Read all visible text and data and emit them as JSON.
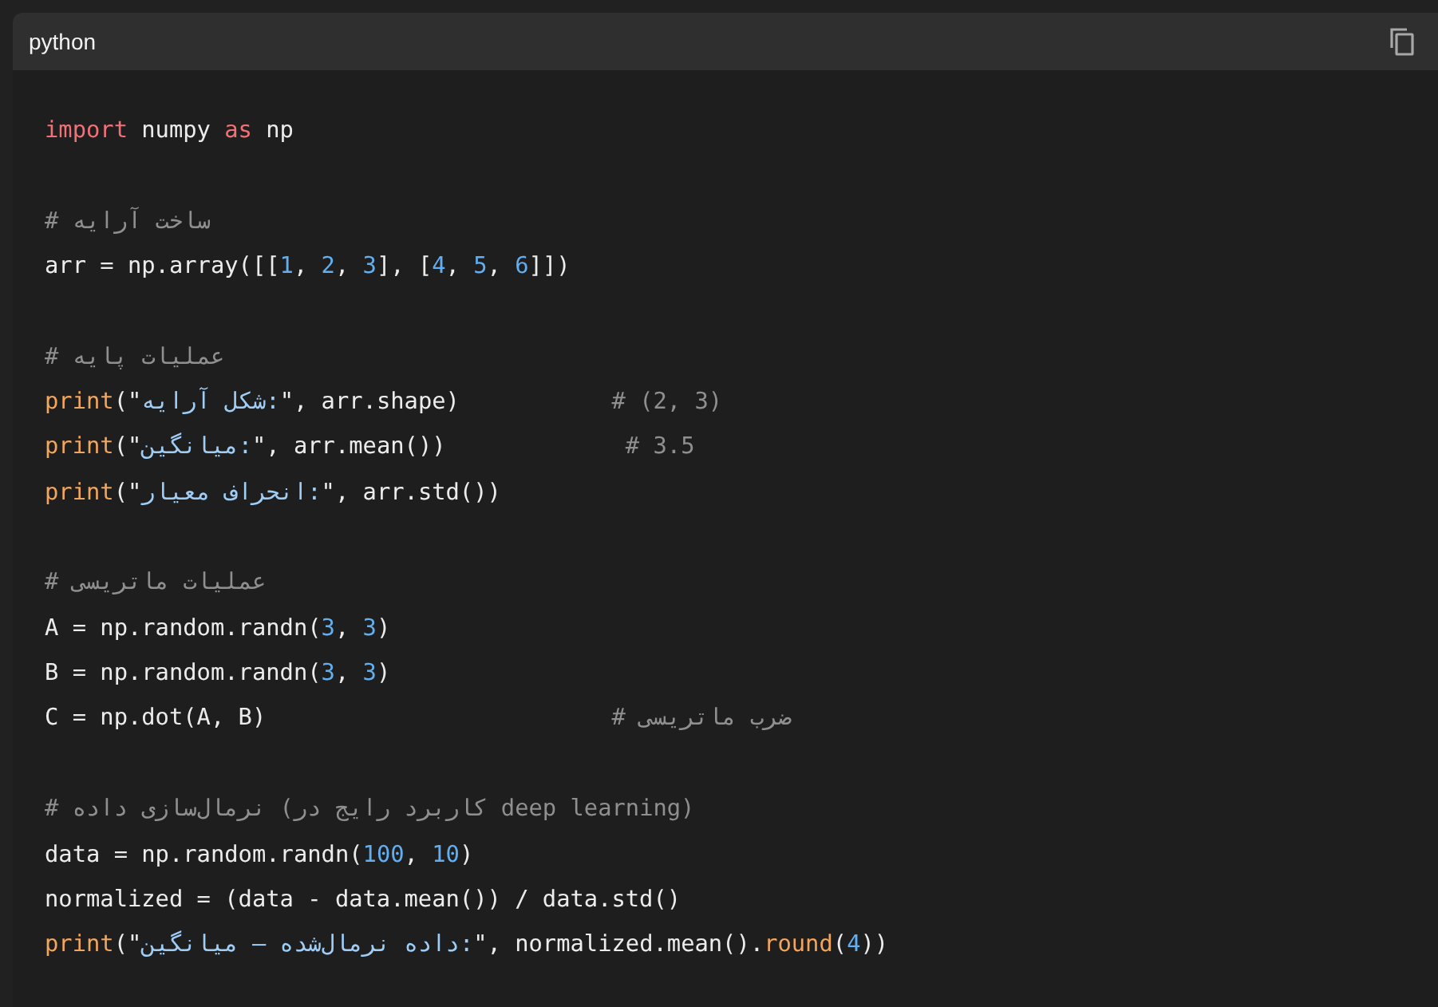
{
  "code_block": {
    "language": "python",
    "lines": [
      {
        "kind": "code",
        "tokens": [
          {
            "kind": "keyword",
            "text": "import"
          },
          {
            "kind": "plain",
            "text": " numpy "
          },
          {
            "kind": "keyword",
            "text": "as"
          },
          {
            "kind": "plain",
            "text": " np"
          }
        ]
      },
      {
        "kind": "blank"
      },
      {
        "kind": "code",
        "tokens": [
          {
            "kind": "comment",
            "text": "# ساخت آرایه"
          }
        ]
      },
      {
        "kind": "code",
        "tokens": [
          {
            "kind": "plain",
            "text": "arr = np.array([["
          },
          {
            "kind": "number",
            "text": "1"
          },
          {
            "kind": "plain",
            "text": ", "
          },
          {
            "kind": "number",
            "text": "2"
          },
          {
            "kind": "plain",
            "text": ", "
          },
          {
            "kind": "number",
            "text": "3"
          },
          {
            "kind": "plain",
            "text": "], ["
          },
          {
            "kind": "number",
            "text": "4"
          },
          {
            "kind": "plain",
            "text": ", "
          },
          {
            "kind": "number",
            "text": "5"
          },
          {
            "kind": "plain",
            "text": ", "
          },
          {
            "kind": "number",
            "text": "6"
          },
          {
            "kind": "plain",
            "text": "]])"
          }
        ]
      },
      {
        "kind": "blank"
      },
      {
        "kind": "code",
        "tokens": [
          {
            "kind": "comment",
            "text": "# عملیات پایه"
          }
        ]
      },
      {
        "kind": "code",
        "tokens": [
          {
            "kind": "builtin",
            "text": "print"
          },
          {
            "kind": "plain",
            "text": "(\""
          },
          {
            "kind": "string",
            "text": "شکل آرایه:"
          },
          {
            "kind": "plain",
            "text": "\", arr.shape)           "
          },
          {
            "kind": "comment",
            "text": "# (2, 3)"
          }
        ]
      },
      {
        "kind": "code",
        "tokens": [
          {
            "kind": "builtin",
            "text": "print"
          },
          {
            "kind": "plain",
            "text": "(\""
          },
          {
            "kind": "string",
            "text": "میانگین:"
          },
          {
            "kind": "plain",
            "text": "\", arr.mean())             "
          },
          {
            "kind": "comment",
            "text": "# 3.5"
          }
        ]
      },
      {
        "kind": "code",
        "tokens": [
          {
            "kind": "builtin",
            "text": "print"
          },
          {
            "kind": "plain",
            "text": "(\""
          },
          {
            "kind": "string",
            "text": "انحراف معیار:"
          },
          {
            "kind": "plain",
            "text": "\", arr.std())"
          }
        ]
      },
      {
        "kind": "blank"
      },
      {
        "kind": "code",
        "tokens": [
          {
            "kind": "comment",
            "text": "# عملیات ماتریسی"
          }
        ]
      },
      {
        "kind": "code",
        "tokens": [
          {
            "kind": "plain",
            "text": "A = np.random.randn("
          },
          {
            "kind": "number",
            "text": "3"
          },
          {
            "kind": "plain",
            "text": ", "
          },
          {
            "kind": "number",
            "text": "3"
          },
          {
            "kind": "plain",
            "text": ")"
          }
        ]
      },
      {
        "kind": "code",
        "tokens": [
          {
            "kind": "plain",
            "text": "B = np.random.randn("
          },
          {
            "kind": "number",
            "text": "3"
          },
          {
            "kind": "plain",
            "text": ", "
          },
          {
            "kind": "number",
            "text": "3"
          },
          {
            "kind": "plain",
            "text": ")"
          }
        ]
      },
      {
        "kind": "code",
        "tokens": [
          {
            "kind": "plain",
            "text": "C = np.dot(A, B)                         "
          },
          {
            "kind": "comment",
            "text": "# ضرب ماتریسی"
          }
        ]
      },
      {
        "kind": "blank"
      },
      {
        "kind": "code",
        "tokens": [
          {
            "kind": "comment",
            "text": "# نرمال‌سازی داده (کاربرد رایج در deep learning)"
          }
        ]
      },
      {
        "kind": "code",
        "tokens": [
          {
            "kind": "plain",
            "text": "data = np.random.randn("
          },
          {
            "kind": "number",
            "text": "100"
          },
          {
            "kind": "plain",
            "text": ", "
          },
          {
            "kind": "number",
            "text": "10"
          },
          {
            "kind": "plain",
            "text": ")"
          }
        ]
      },
      {
        "kind": "code",
        "tokens": [
          {
            "kind": "plain",
            "text": "normalized = (data - data.mean()) / data.std()"
          }
        ]
      },
      {
        "kind": "code",
        "tokens": [
          {
            "kind": "builtin",
            "text": "print"
          },
          {
            "kind": "plain",
            "text": "(\""
          },
          {
            "kind": "string",
            "text": "داده نرمال‌شده – میانگین:"
          },
          {
            "kind": "plain",
            "text": "\", normalized.mean()."
          },
          {
            "kind": "builtin",
            "text": "round"
          },
          {
            "kind": "plain",
            "text": "("
          },
          {
            "kind": "number",
            "text": "4"
          },
          {
            "kind": "plain",
            "text": "))"
          }
        ]
      }
    ]
  }
}
